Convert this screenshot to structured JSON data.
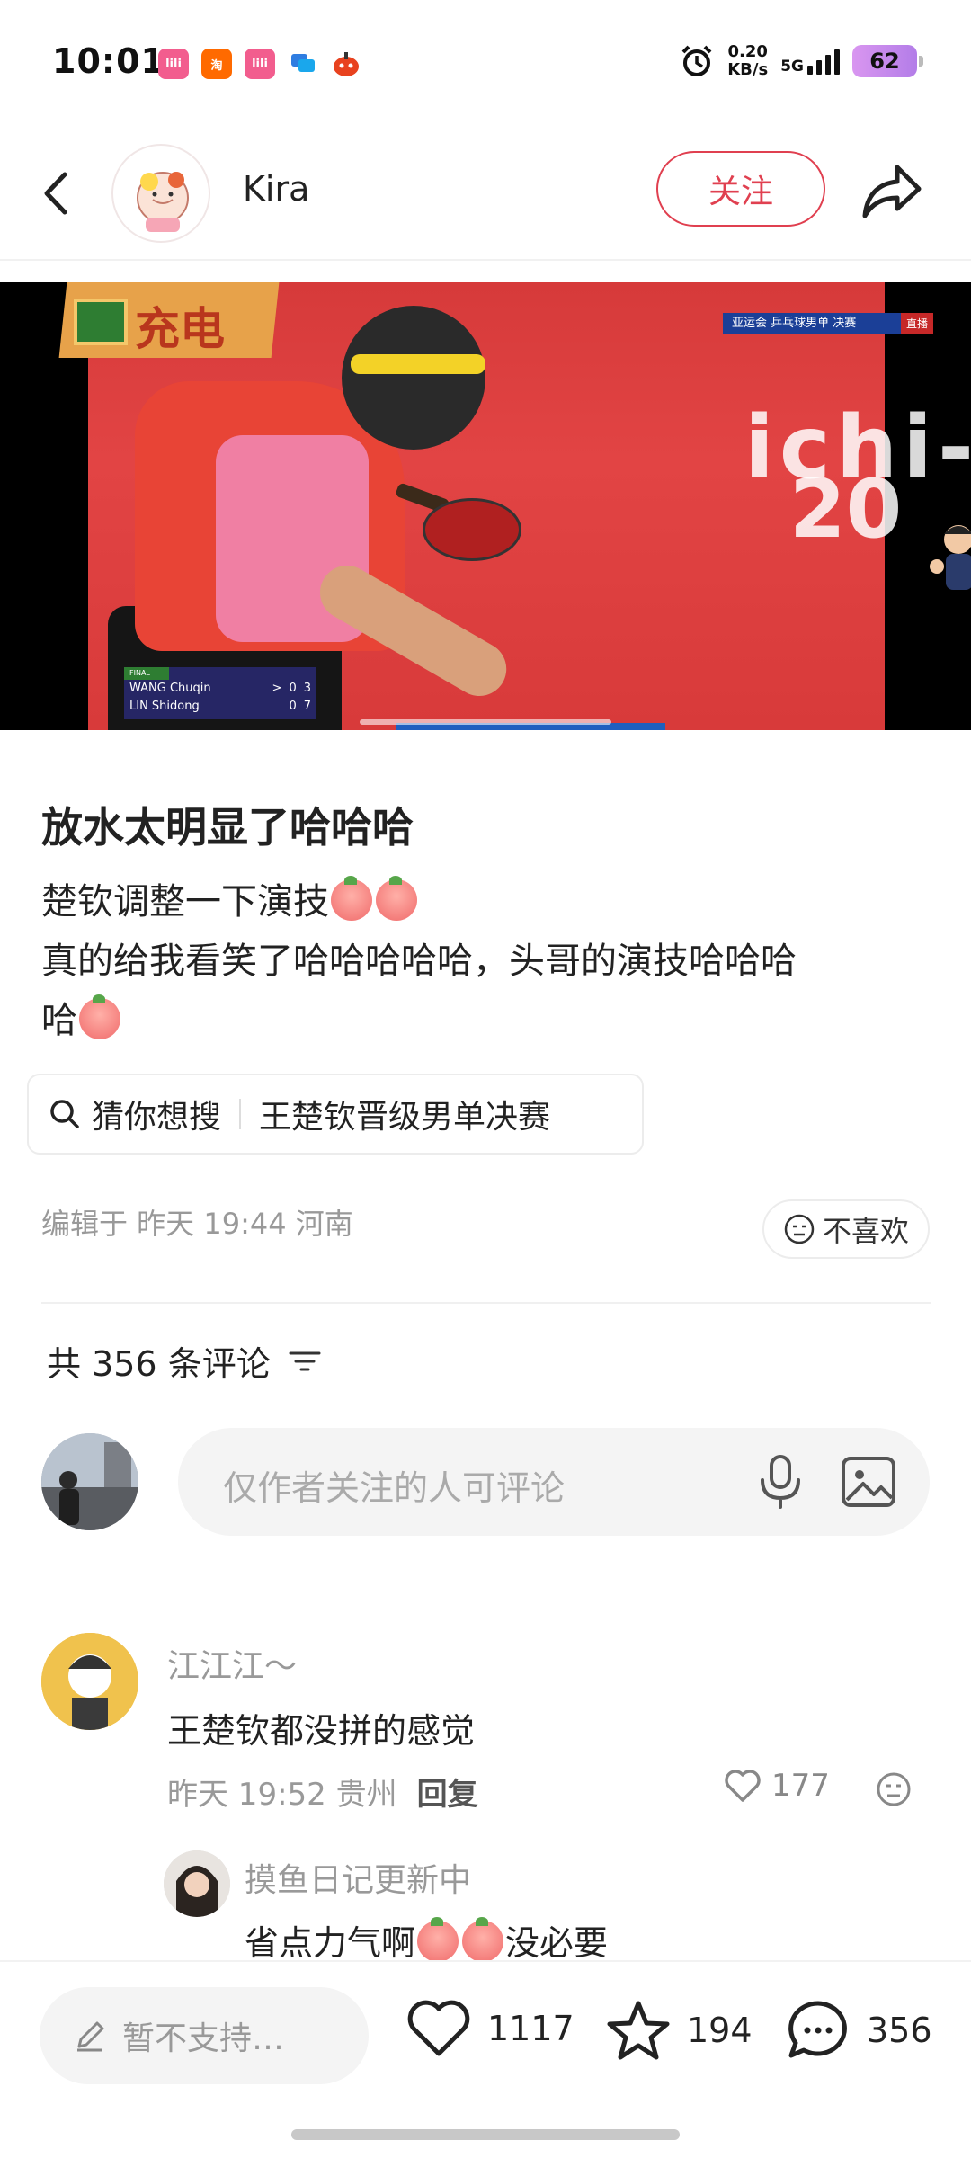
{
  "status_bar": {
    "time": "10:01",
    "speed_value": "0.20",
    "speed_unit": "KB/s",
    "network": "5G",
    "battery": "62",
    "app_icons": [
      "bilibili-icon",
      "taobao-icon",
      "bilibili-icon",
      "chat-icon",
      "fire-icon"
    ],
    "app_icon_labels": [
      "lili",
      "淘",
      "lili",
      "",
      ""
    ]
  },
  "header": {
    "author_name": "Kira",
    "follow_label": "关注"
  },
  "video": {
    "ad_text": "充电",
    "broadcast_text": "亚运会 乒乓球男单 决赛",
    "live_label": "直播",
    "court_text_1": "ichi-",
    "court_text_2": "20",
    "scoreboard": {
      "tag": "FINAL",
      "rows": [
        {
          "name": "WANG Chuqin",
          "serve": ">",
          "game": "0",
          "points": "3"
        },
        {
          "name": "LIN Shidong",
          "serve": "",
          "game": "0",
          "points": "7"
        }
      ]
    }
  },
  "post": {
    "title": "放水太明显了哈哈哈",
    "line1": "楚钦调整一下演技",
    "line2a": "真的给我看笑了哈哈哈哈哈，头哥的演技哈哈哈",
    "line2b": "哈",
    "search_label": "猜你想搜",
    "search_query": "王楚钦晋级男单决赛",
    "meta": "编辑于  昨天 19:44  河南",
    "dislike_label": "不喜欢"
  },
  "comments_section": {
    "count_label": "共 356 条评论",
    "input_placeholder": "仅作者关注的人可评论"
  },
  "comments": [
    {
      "name": "江江江～",
      "text": "王楚钦都没拼的感觉",
      "time": "昨天 19:52 贵州",
      "reply_label": "回复",
      "likes": "177"
    },
    {
      "name": "摸鱼日记更新中",
      "text_a": "省点力气啊",
      "text_b": "没必要"
    }
  ],
  "bottom_bar": {
    "input_label": "暂不支持…",
    "likes": "1117",
    "favorites": "194",
    "comments": "356"
  },
  "colors": {
    "accent": "#e04050",
    "court": "#e24444",
    "text": "#222222",
    "muted": "#999999"
  }
}
